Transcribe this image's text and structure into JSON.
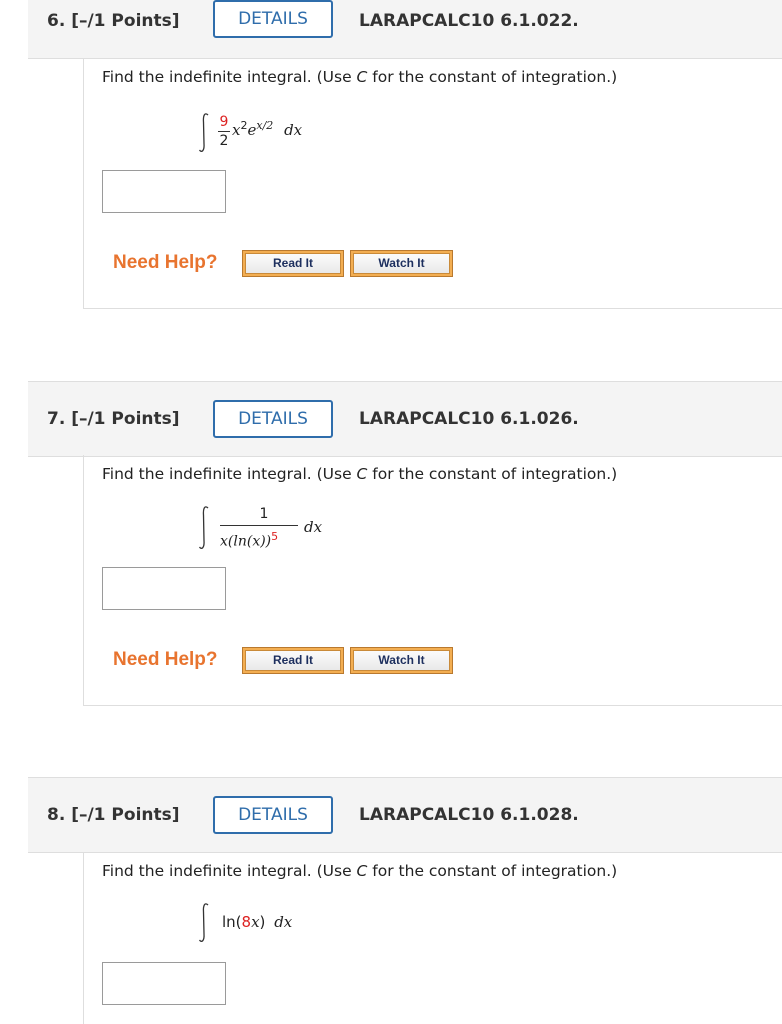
{
  "questions": [
    {
      "number_label": "6. [–/1 Points]",
      "details_label": "DETAILS",
      "reference": "LARAPCALC10 6.1.022.",
      "prompt_before": "Find the indefinite integral. (Use ",
      "prompt_var": "C",
      "prompt_after": " for the constant of integration.)",
      "integral": {
        "coef_num": "9",
        "coef_den": "2",
        "base": "x",
        "exp1": "2",
        "exp_base": "e",
        "exp2": "x/2",
        "differential": "dx"
      },
      "answer_value": "",
      "need_help": "Need Help?",
      "read_label": "Read It",
      "watch_label": "Watch It"
    },
    {
      "number_label": "7. [–/1 Points]",
      "details_label": "DETAILS",
      "reference": "LARAPCALC10 6.1.026.",
      "prompt_before": "Find the indefinite integral. (Use ",
      "prompt_var": "C",
      "prompt_after": " for the constant of integration.)",
      "integral": {
        "numerator": "1",
        "den_pre": "x(ln(x))",
        "den_exp": "5",
        "differential": "dx"
      },
      "answer_value": "",
      "need_help": "Need Help?",
      "read_label": "Read It",
      "watch_label": "Watch It"
    },
    {
      "number_label": "8. [–/1 Points]",
      "details_label": "DETAILS",
      "reference": "LARAPCALC10 6.1.028.",
      "prompt_before": "Find the indefinite integral. (Use ",
      "prompt_var": "C",
      "prompt_after": " for the constant of integration.)",
      "integral": {
        "pre": "ln(",
        "coef": "8",
        "var": "x",
        "post": ")",
        "differential": "dx"
      },
      "answer_value": ""
    }
  ],
  "colors": {
    "accent": "#2f6dab",
    "help": "#e8742f",
    "highlight": "#dd2222"
  }
}
